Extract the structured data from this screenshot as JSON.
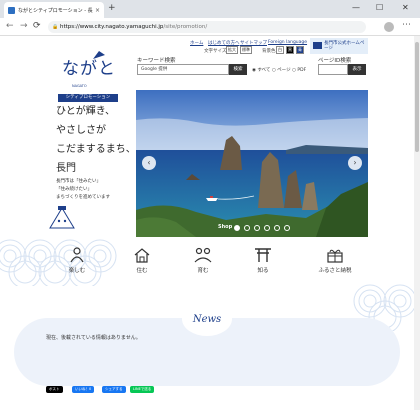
{
  "browser": {
    "tab_title": "ながとシティプロモーション - 長門市出",
    "tab_close": "×",
    "new_tab": "+",
    "url_host": "https://www.city.nagato.yamaguchi.jp",
    "url_path": "/site/promotion/",
    "minimize": "—",
    "maximize": "☐",
    "close": "✕",
    "back": "←",
    "forward": "→",
    "reload": "⟳",
    "menu": "⋯"
  },
  "header": {
    "logo_text": "ながと",
    "logo_small": "NAGATO",
    "logo_sub": "シティプロモーション",
    "links": [
      "ホーム",
      "はじめての方へ",
      "サイトマップ",
      "Foreign language"
    ],
    "font_size_label": "文字サイズ",
    "font_size_options": [
      "拡大",
      "標準"
    ],
    "contrast_label": "背景色",
    "contrast_options": [
      "白",
      "黒",
      "青"
    ],
    "official_label": "長門市公式ホームページ"
  },
  "search": {
    "keyword_title": "キーワード検索",
    "keyword_placeholder": "Google 提供",
    "keyword_button": "検索",
    "radio_all": "◉ すべて",
    "radio_page": "○ ページ",
    "radio_pdf": "○ PDF",
    "page_id_title": "ページID検索",
    "page_id_button": "表示"
  },
  "hero": {
    "lines": [
      "ひとが輝き、",
      "やさしさが",
      "こだまするまち、",
      "長門"
    ],
    "sub_lines": [
      "長門市は「住みたい」",
      "「住み続けたい」",
      "まちづくりを進めています"
    ],
    "shop_label": "Shop",
    "prev": "‹",
    "next": "›",
    "slide_count": 6,
    "active_slide": 1
  },
  "nav": [
    {
      "label": "楽しむ",
      "icon": "person-icon"
    },
    {
      "label": "住む",
      "icon": "house-icon"
    },
    {
      "label": "育む",
      "icon": "family-icon"
    },
    {
      "label": "知る",
      "icon": "torii-icon"
    },
    {
      "label": "ふるさと納税",
      "icon": "gift-icon"
    }
  ],
  "news": {
    "title": "News",
    "message": "現在、後載されている情報はありません。"
  },
  "share": [
    "ポスト",
    "いいね！0",
    "シェアする",
    "LINEで送る"
  ],
  "colors": {
    "brand": "#1e3f8a",
    "news_band": "#edf2fa"
  }
}
